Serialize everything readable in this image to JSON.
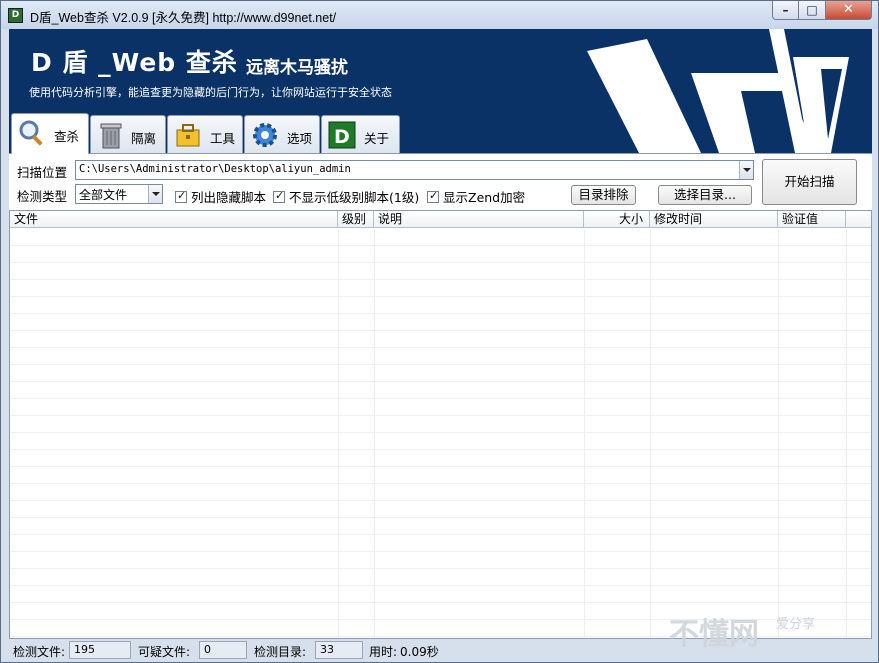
{
  "window": {
    "title": "D盾_Web查杀 V2.0.9 [永久免费] http://www.d99net.net/",
    "app_icon": "d-shield-app-icon",
    "caption": {
      "minimize": "–",
      "maximize": "□",
      "close": "✕"
    }
  },
  "banner": {
    "title": "D 盾 _Web 查杀",
    "slogan": "远离木马骚扰",
    "description": "使用代码分析引擎，能追查更为隐藏的后门行为，让你网站运行于安全状态",
    "background_color": "#0a3266"
  },
  "tabs": [
    {
      "label": "查杀",
      "icon": "magnifier-icon",
      "active": true
    },
    {
      "label": "隔离",
      "icon": "trash-bin-icon",
      "active": false
    },
    {
      "label": "工具",
      "icon": "toolbox-icon",
      "active": false
    },
    {
      "label": "选项",
      "icon": "gear-icon",
      "active": false
    },
    {
      "label": "关于",
      "icon": "d-logo-icon",
      "active": false
    }
  ],
  "scan": {
    "path_label": "扫描位置",
    "path_value": "C:\\Users\\Administrator\\Desktop\\aliyun_admin",
    "type_label": "检测类型",
    "type_value": "全部文件",
    "check_hidden": {
      "label": "列出隐藏脚本",
      "checked": true
    },
    "check_lowlevel": {
      "label": "不显示低级别脚本(1级)",
      "checked": true
    },
    "check_zend": {
      "label": "显示Zend加密",
      "checked": true
    },
    "exclude_button": "目录排除",
    "select_dir_button": "选择目录...",
    "start_button": "开始扫描"
  },
  "table": {
    "columns": [
      "文件",
      "级别",
      "说明",
      "大小",
      "修改时间",
      "验证值"
    ],
    "rows": []
  },
  "status": {
    "files_label": "检测文件:",
    "files_value": "195",
    "suspicious_label": "可疑文件:",
    "suspicious_value": "0",
    "dirs_label": "检测目录:",
    "dirs_value": "33",
    "time_label": "用时:",
    "time_value": "0.09秒"
  },
  "watermark": {
    "text": "不懂网",
    "small": "爱分享"
  }
}
